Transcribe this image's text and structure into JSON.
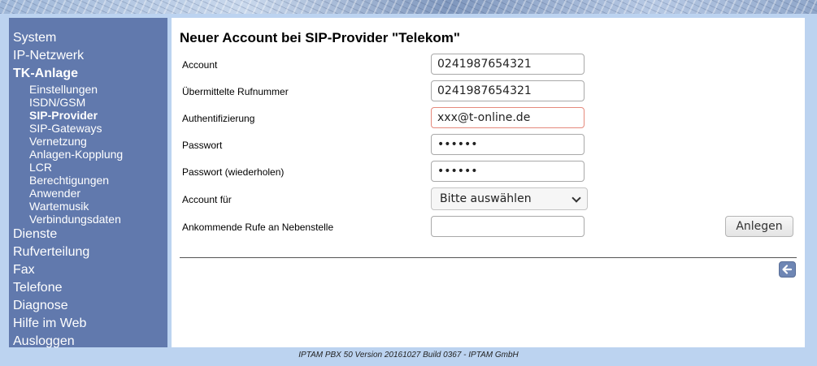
{
  "sidebar": {
    "items": [
      {
        "label": "System"
      },
      {
        "label": "IP-Netzwerk"
      },
      {
        "label": "TK-Anlage"
      },
      {
        "label": "Dienste"
      },
      {
        "label": "Rufverteilung"
      },
      {
        "label": "Fax"
      },
      {
        "label": "Telefone"
      },
      {
        "label": "Diagnose"
      },
      {
        "label": "Hilfe im Web"
      },
      {
        "label": "Ausloggen"
      }
    ],
    "tk_subitems": [
      {
        "label": "Einstellungen"
      },
      {
        "label": "ISDN/GSM"
      },
      {
        "label": "SIP-Provider"
      },
      {
        "label": "SIP-Gateways"
      },
      {
        "label": "Vernetzung"
      },
      {
        "label": "Anlagen-Kopplung"
      },
      {
        "label": "LCR"
      },
      {
        "label": "Berechtigungen"
      },
      {
        "label": "Anwender"
      },
      {
        "label": "Wartemusik"
      },
      {
        "label": "Verbindungsdaten"
      }
    ]
  },
  "form": {
    "title": "Neuer Account bei SIP-Provider \"Telekom\"",
    "account": {
      "label": "Account",
      "value": "0241987654321"
    },
    "caller_number": {
      "label": "Übermittelte Rufnummer",
      "value": "0241987654321"
    },
    "authentication": {
      "label": "Authentifizierung",
      "value": "xxx@t-online.de"
    },
    "password": {
      "label": "Passwort",
      "value": "••••••"
    },
    "password_repeat": {
      "label": "Passwort (wiederholen)",
      "value": "••••••"
    },
    "account_for": {
      "label": "Account für",
      "selected": "Bitte auswählen"
    },
    "incoming_calls": {
      "label": "Ankommende Rufe an Nebenstelle",
      "value": ""
    },
    "submit_label": "Anlegen"
  },
  "icons": {
    "back": "back-arrow-icon"
  },
  "colors": {
    "sidebar": "#6179ad",
    "page_background": "#bcd3f0",
    "focus_border": "#e5897c"
  },
  "footer": {
    "text": "IPTAM PBX 50 Version 20161027 Build 0367 - IPTAM GmbH"
  }
}
